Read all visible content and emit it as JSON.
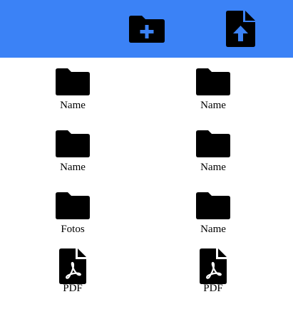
{
  "toolbar": {
    "background": "#3b82f6",
    "new_folder_icon": "folder-plus-icon",
    "upload_icon": "file-upload-icon"
  },
  "items": [
    {
      "label": "Name",
      "type": "folder",
      "icon": "folder-icon"
    },
    {
      "label": "Name",
      "type": "folder",
      "icon": "folder-icon"
    },
    {
      "label": "Name",
      "type": "folder",
      "icon": "folder-icon"
    },
    {
      "label": "Name",
      "type": "folder",
      "icon": "folder-icon"
    },
    {
      "label": "Fotos",
      "type": "folder",
      "icon": "folder-icon"
    },
    {
      "label": "Name",
      "type": "folder",
      "icon": "folder-icon"
    },
    {
      "label": "PDF",
      "type": "pdf",
      "icon": "pdf-file-icon"
    },
    {
      "label": "PDF",
      "type": "pdf",
      "icon": "pdf-file-icon"
    }
  ]
}
